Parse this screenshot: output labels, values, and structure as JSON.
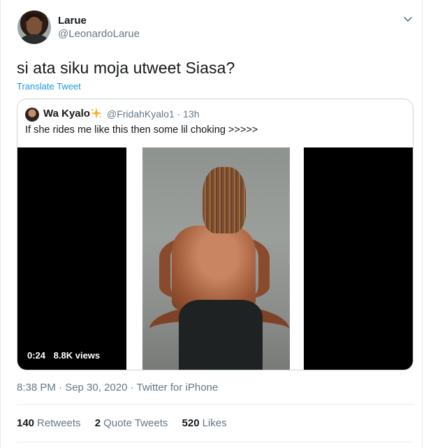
{
  "tweet": {
    "author_name": "Larue",
    "author_handle": "@LeonardoLarue",
    "text": "si ata siku moja utweet Siasa?",
    "translate_label": "Translate Tweet",
    "timestamp": "8:38 PM · Sep 30, 2020 · Twitter for iPhone",
    "icons": {
      "menu": "chevron-down-icon"
    }
  },
  "quoted": {
    "author_name": "Wa Kyalo",
    "author_handle": "@FridahKyalo1 · 13h",
    "text": "If she rides me like this then some lil choking >>>>>",
    "icons": {
      "name_emoji": "sparkles-icon"
    },
    "video": {
      "duration": "0:24",
      "views": "8.8K views"
    }
  },
  "stats": {
    "retweets_count": "140",
    "retweets_label": "Retweets",
    "quotes_count": "2",
    "quotes_label": "Quote Tweets",
    "likes_count": "520",
    "likes_label": "Likes"
  },
  "colors": {
    "accent": "#1b95e0",
    "secondary_text": "#657786",
    "border": "#ccd6dd"
  }
}
